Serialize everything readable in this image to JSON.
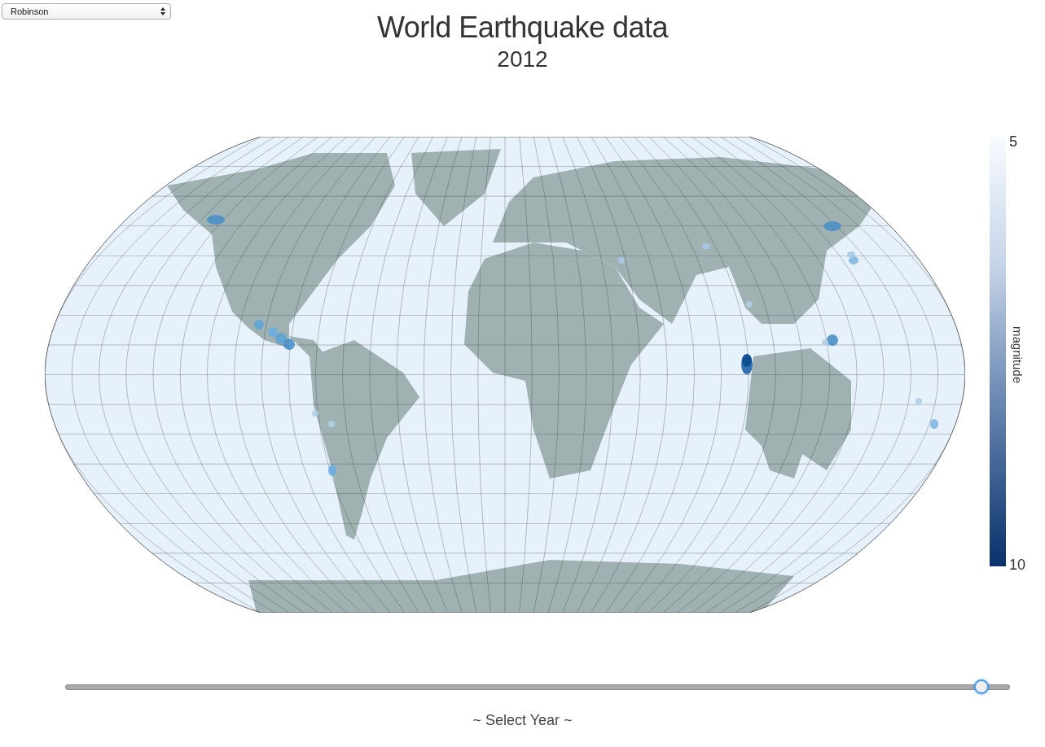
{
  "projection_dropdown": {
    "value": "Robinson"
  },
  "title": "World Earthquake data",
  "subtitle": "2012",
  "legend": {
    "title": "magnitude",
    "min_label": "5",
    "max_label": "10"
  },
  "year_slider": {
    "level": 0.97,
    "label": "~ Select Year ~"
  }
}
